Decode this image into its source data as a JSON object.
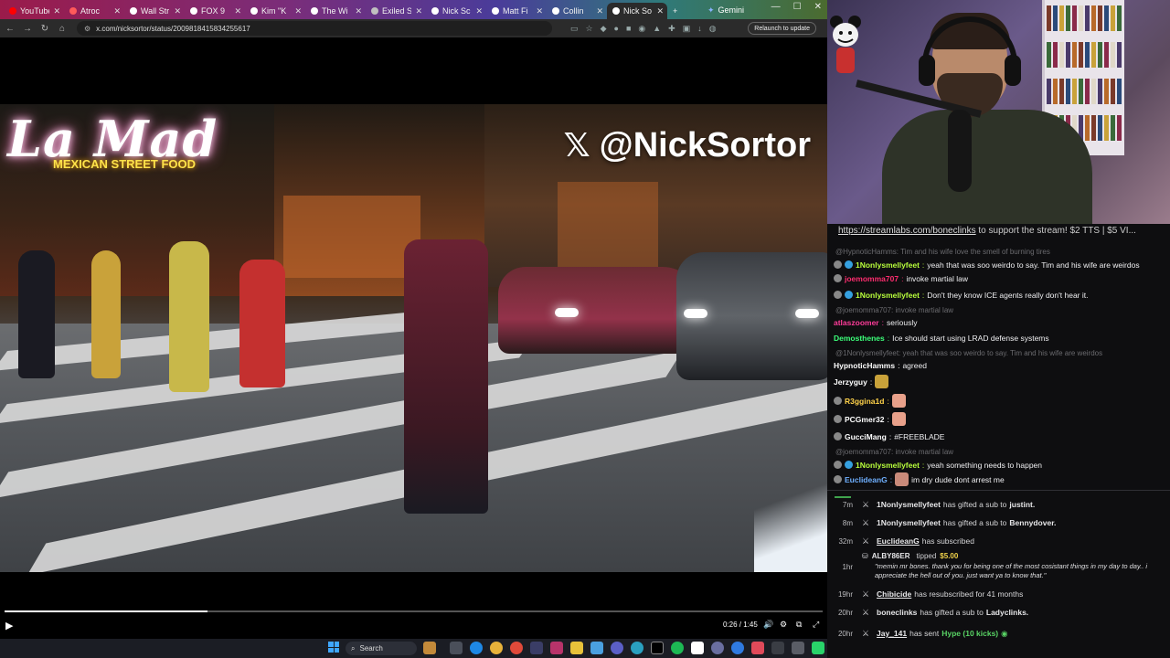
{
  "browser": {
    "tabs": [
      {
        "label": "YouTube",
        "color": "#ff0000"
      },
      {
        "label": "Atroc",
        "color": "#ff5a5a"
      },
      {
        "label": "Wall Str",
        "color": "#ffffff"
      },
      {
        "label": "FOX 9",
        "color": "#ffffff"
      },
      {
        "label": "Kim \"K",
        "color": "#ffffff"
      },
      {
        "label": "The Wi",
        "color": "#ffffff"
      },
      {
        "label": "Exiled Syria",
        "color": "#c0c0c0"
      },
      {
        "label": "Nick Sc",
        "color": "#ffffff"
      },
      {
        "label": "Matt Fi",
        "color": "#ffffff"
      },
      {
        "label": "Collin",
        "color": "#ffffff"
      },
      {
        "label": "Nick So",
        "color": "#ffffff"
      }
    ],
    "gemini_label": "Gemini",
    "url": "x.com/nicksortor/status/2009818415834255617",
    "relaunch_label": "Relaunch to update"
  },
  "video": {
    "sign_text": "La Mad",
    "sign_subtitle": "MEXICAN STREET FOOD",
    "watermark_handle": "@NickSortor",
    "time_display": "0:26 / 1:45",
    "progress": 0.248
  },
  "taskbar": {
    "search_label": "Search"
  },
  "stream": {
    "link_url": "https://streamlabs.com/boneclinks",
    "link_suffix": " to support the stream! $2 TTS | $5 VI..."
  },
  "chat": [
    {
      "type": "reply",
      "text": "@HypnoticHamms: Tim and his wife love the smell of burning tires"
    },
    {
      "type": "msg",
      "user": "1Nonlysmellyfeet",
      "color": "#b9ff3c",
      "badges": [
        "#888",
        "#35a0e0"
      ],
      "text": "yeah that was soo weirdo to say. Tim and his wife are weirdos"
    },
    {
      "type": "msg",
      "user": "joemomma707",
      "color": "#ff2d6f",
      "badges": [
        "#888"
      ],
      "text": "invoke martial law"
    },
    {
      "type": "msg",
      "user": "1Nonlysmellyfeet",
      "color": "#b9ff3c",
      "badges": [
        "#888",
        "#35a0e0"
      ],
      "text": "Don't they know ICE agents really don't hear it."
    },
    {
      "type": "reply",
      "text": "@joemomma707: invoke martial law"
    },
    {
      "type": "msg",
      "user": "atlaszoomer",
      "color": "#ff3c9a",
      "badges": [],
      "text": "seriously"
    },
    {
      "type": "msg",
      "user": "Demosthenes",
      "color": "#3cff7a",
      "badges": [],
      "text": "Ice should start using LRAD defense systems"
    },
    {
      "type": "reply",
      "text": "@1Nonlysmellyfeet: yeah that was soo weirdo to say. Tim and his wife are weirdos"
    },
    {
      "type": "msg",
      "user": "HypnoticHamms",
      "color": "#ffffff",
      "badges": [],
      "text": "agreed"
    },
    {
      "type": "msg",
      "user": "Jerzyguy",
      "color": "#ffffff",
      "badges": [],
      "text": "",
      "emote": "#c9a23a"
    },
    {
      "type": "msg",
      "user": "R3ggina1d",
      "color": "#ffd24a",
      "badges": [
        "#888"
      ],
      "text": "",
      "emote": "#e8a08a"
    },
    {
      "type": "msg",
      "user": "PCGmer32",
      "color": "#ffffff",
      "badges": [
        "#888"
      ],
      "text": "",
      "emote": "#e8a08a"
    },
    {
      "type": "msg",
      "user": "GucciMang",
      "color": "#ffffff",
      "badges": [
        "#888"
      ],
      "text": "#FREEBLADE"
    },
    {
      "type": "reply",
      "text": "@joemomma707: invoke martial law"
    },
    {
      "type": "msg",
      "user": "1Nonlysmellyfeet",
      "color": "#b9ff3c",
      "badges": [
        "#888",
        "#35a0e0"
      ],
      "text": "yeah something needs to happen"
    },
    {
      "type": "msg",
      "user": "EuclideanG",
      "color": "#6fb0ff",
      "badges": [
        "#888"
      ],
      "text": "im dry dude dont arrest me",
      "emote": "#c98a7a"
    }
  ],
  "events": [
    {
      "time": "7m",
      "name": "1Nonlysmellyfeet",
      "underline": false,
      "text": "has gifted a sub to",
      "target": "justint."
    },
    {
      "time": "8m",
      "name": "1Nonlysmellyfeet",
      "underline": false,
      "text": "has gifted a sub to",
      "target": "Bennydover."
    },
    {
      "time": "32m",
      "name": "EuclideanG",
      "underline": true,
      "text": "has subscribed",
      "target": ""
    },
    {
      "time": "19hr",
      "name": "Chibicide",
      "underline": true,
      "text": "has resubscribed for 41 months",
      "target": ""
    },
    {
      "time": "20hr",
      "name": "boneclinks",
      "underline": false,
      "text": "has gifted a sub to",
      "target": "Ladyclinks."
    },
    {
      "time": "20hr",
      "name": "Jay_141",
      "underline": true,
      "text": "has sent",
      "hype": "Hype (10 kicks)"
    }
  ],
  "tip": {
    "time": "1hr",
    "name": "ALBY86ER",
    "verb": "tipped",
    "amount": "$5.00",
    "message": "\"memin mr bones. thank you for being one of the most cosistant things in my day to day.. i appreciate the hell out of you. just want ya to know that.\""
  }
}
